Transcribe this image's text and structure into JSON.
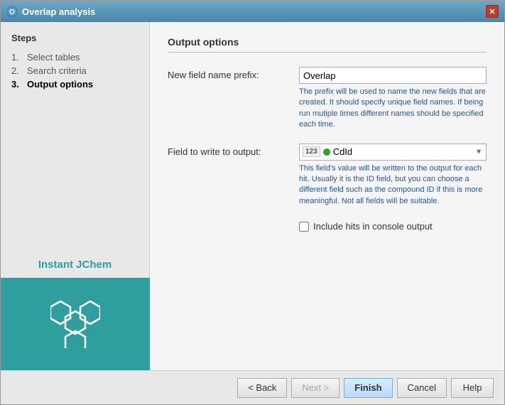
{
  "dialog": {
    "title": "Overlap analysis",
    "close_label": "✕"
  },
  "sidebar": {
    "steps_title": "Steps",
    "steps": [
      {
        "num": "1.",
        "label": "Select tables",
        "active": false
      },
      {
        "num": "2.",
        "label": "Search criteria",
        "active": false
      },
      {
        "num": "3.",
        "label": "Output options",
        "active": true
      }
    ],
    "brand_name": "Instant JChem"
  },
  "main": {
    "section_title": "Output options",
    "field_prefix_label": "New field name prefix:",
    "field_prefix_value": "Overlap",
    "field_prefix_hint": "The prefix will be used to name the new fields that are created. It should specify unique field names. If being run mutiple times different names should be specified each time.",
    "field_output_label": "Field to write to output:",
    "field_output_value": "CdId",
    "field_output_badge": "123",
    "field_output_hint": "This field's value will be written to the output for each hit. Usually it is the ID field, but you can choose a different field such as the compound ID if this is more meaningful. Not all fields will be suitable.",
    "checkbox_label": "Include hits in console output",
    "checkbox_checked": false
  },
  "footer": {
    "back_label": "< Back",
    "next_label": "Next >",
    "finish_label": "Finish",
    "cancel_label": "Cancel",
    "help_label": "Help"
  }
}
